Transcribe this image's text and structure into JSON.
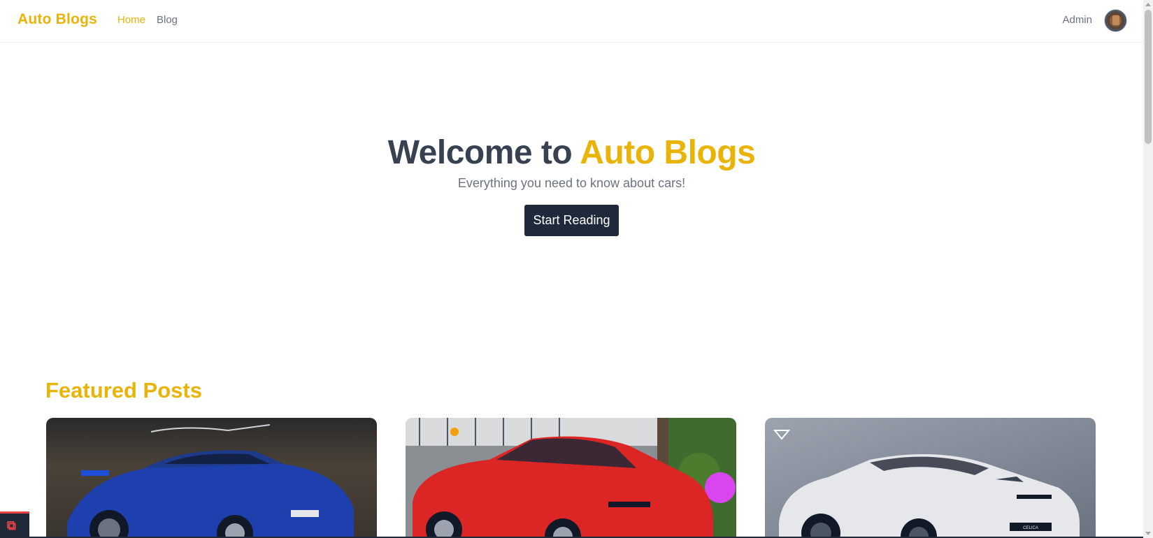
{
  "navbar": {
    "brand": "Auto Blogs",
    "links": [
      {
        "label": "Home",
        "active": true
      },
      {
        "label": "Blog",
        "active": false
      }
    ],
    "user_label": "Admin",
    "accent_color": "#eab308"
  },
  "hero": {
    "title_prefix": "Welcome to",
    "title_accent": "Auto Blogs",
    "subtitle": "Everything you need to know about cars!",
    "cta_label": "Start Reading"
  },
  "featured": {
    "title": "Featured Posts",
    "posts": [
      {
        "image": "blue sports car in garage",
        "color": "#1d4ed8"
      },
      {
        "image": "red sports car on street",
        "color": "#dc2626"
      },
      {
        "image": "white concept sports car",
        "color": "#e5e7eb",
        "plate_text": "CELICA"
      }
    ]
  },
  "icons": {
    "avatar": "avatar-icon",
    "debug_badge": "laravel-icon"
  }
}
